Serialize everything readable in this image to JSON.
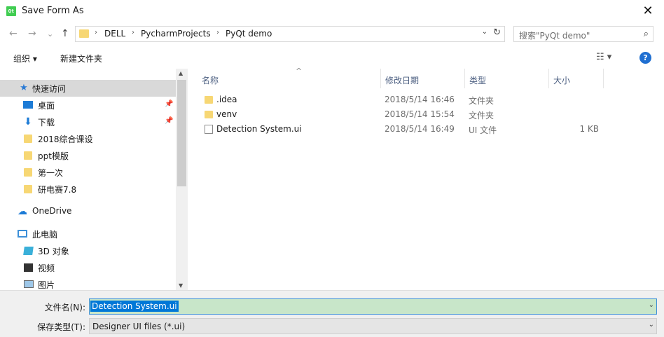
{
  "window": {
    "title": "Save Form As",
    "icon_text": "Qt",
    "close_glyph": "✕"
  },
  "nav": {
    "back_glyph": "←",
    "forward_glyph": "→",
    "recent_glyph": "⌄",
    "up_glyph": "↑",
    "breadcrumbs": [
      "DELL",
      "PycharmProjects",
      "PyQt demo"
    ],
    "sep_glyph": "›",
    "dropdown_glyph": "⌄",
    "refresh_glyph": "↻",
    "search_placeholder": "搜索\"PyQt demo\"",
    "search_glyph": "⌕"
  },
  "toolbar": {
    "organize_label": "组织 ▾",
    "new_folder_label": "新建文件夹",
    "view_glyph": "☷ ▾",
    "help_glyph": "?"
  },
  "sidebar": {
    "pin_glyph": "📌",
    "items": [
      {
        "label": "快速访问",
        "icon": "star-icon",
        "glyph": "★"
      },
      {
        "label": "桌面",
        "icon": "desktop-icon",
        "glyph": ""
      },
      {
        "label": "下载",
        "icon": "download-icon",
        "glyph": "⬇"
      },
      {
        "label": "2018综合课设",
        "icon": "folder-icon",
        "glyph": ""
      },
      {
        "label": "ppt模版",
        "icon": "folder-icon",
        "glyph": ""
      },
      {
        "label": "第一次",
        "icon": "folder-icon",
        "glyph": ""
      },
      {
        "label": "研电赛7.8",
        "icon": "folder-icon",
        "glyph": ""
      },
      {
        "label": "OneDrive",
        "icon": "cloud-icon",
        "glyph": "☁"
      },
      {
        "label": "此电脑",
        "icon": "computer-icon",
        "glyph": ""
      },
      {
        "label": "3D 对象",
        "icon": "cube-icon",
        "glyph": ""
      },
      {
        "label": "视频",
        "icon": "film-icon",
        "glyph": ""
      },
      {
        "label": "图片",
        "icon": "picture-icon",
        "glyph": ""
      }
    ],
    "scroll_up_glyph": "▲",
    "scroll_down_glyph": "▼"
  },
  "columns": {
    "name": "名称",
    "date": "修改日期",
    "type": "类型",
    "size": "大小",
    "sort_glyph": "^"
  },
  "files": [
    {
      "name": ".idea",
      "date": "2018/5/14 16:46",
      "type": "文件夹",
      "size": "",
      "icon": "folder-icon"
    },
    {
      "name": "venv",
      "date": "2018/5/14 15:54",
      "type": "文件夹",
      "size": "",
      "icon": "folder-icon"
    },
    {
      "name": "Detection System.ui",
      "date": "2018/5/14 16:49",
      "type": "UI 文件",
      "size": "1 KB",
      "icon": "document-icon"
    }
  ],
  "footer": {
    "filename_label": "文件名(N):",
    "filename_value": "Detection System.ui",
    "filetype_label": "保存类型(T):",
    "filetype_value": "Designer UI files (*.ui)",
    "dropdown_glyph": "⌄"
  }
}
